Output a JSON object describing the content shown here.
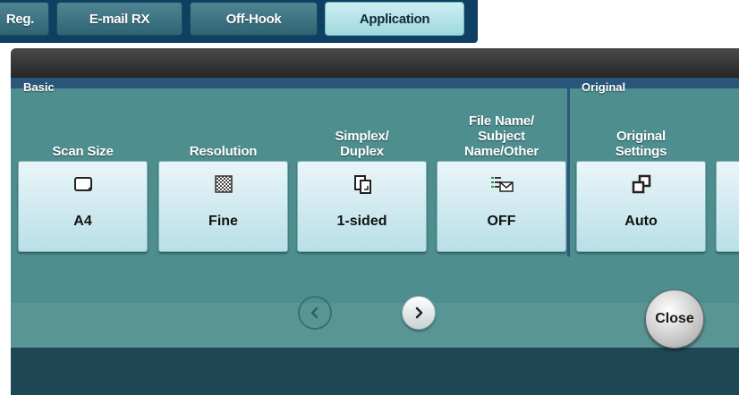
{
  "tabs": [
    {
      "label": "Reg."
    },
    {
      "label": "E-mail RX"
    },
    {
      "label": "Off-Hook"
    },
    {
      "label": "Application"
    }
  ],
  "sections": {
    "basic": "Basic",
    "original": "Original"
  },
  "functions": [
    {
      "caption": "Scan Size",
      "value": "A4",
      "icon": "paper-size-icon"
    },
    {
      "caption": "Resolution",
      "value": "Fine",
      "icon": "resolution-icon"
    },
    {
      "caption": "Simplex/\nDuplex",
      "value": "1-sided",
      "icon": "simplex-duplex-icon"
    },
    {
      "caption": "File Name/\nSubject\nName/Other",
      "value": "OFF",
      "icon": "file-name-subject-icon"
    },
    {
      "caption": "Original\nSettings",
      "value": "Auto",
      "icon": "original-settings-icon"
    }
  ],
  "close_label": "Close",
  "colors": {
    "accent": "#4e8e8f",
    "section_bar": "#2a567c",
    "button_face": "#d7eef2"
  }
}
